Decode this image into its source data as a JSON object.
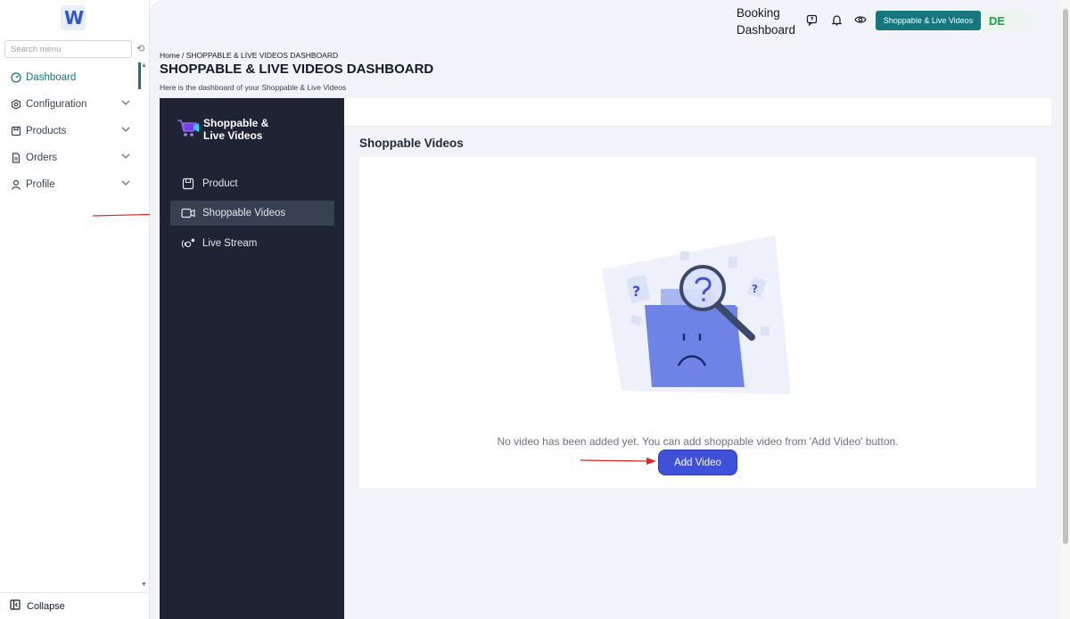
{
  "sidebar": {
    "logo_text": "W",
    "search_placeholder": "Search menu",
    "items": [
      {
        "label": "Dashboard",
        "icon": "dashboard-icon",
        "active": true
      },
      {
        "label": "Configuration",
        "icon": "settings-icon"
      },
      {
        "label": "Products",
        "icon": "products-icon"
      },
      {
        "label": "Orders",
        "icon": "orders-icon"
      },
      {
        "label": "Profile",
        "icon": "user-icon"
      }
    ],
    "collapse_label": "Collapse"
  },
  "topbar": {
    "booking_label": "Booking Dashboard",
    "app_button": "Shoppable & Live Videos",
    "user_initials": "DE"
  },
  "header": {
    "breadcrumb": "Home / SHOPPABLE & LIVE VIDEOS DASHBOARD",
    "title": "SHOPPABLE & LIVE VIDEOS DASHBOARD",
    "subtitle": "Here is the dashboard of your Shoppable & Live Videos"
  },
  "panel": {
    "brand": "Shoppable & Live Videos",
    "items": [
      {
        "label": "Product",
        "icon": "product-icon"
      },
      {
        "label": "Shoppable Videos",
        "icon": "video-icon",
        "active": true
      },
      {
        "label": "Live Stream",
        "icon": "live-stream-icon"
      }
    ]
  },
  "content": {
    "section_title": "Shoppable Videos",
    "empty_message": "No video has been added yet. You can add shoppable video from 'Add Video' button.",
    "add_button": "Add Video"
  },
  "colors": {
    "accent": "#15767d",
    "primary_button": "#3f51d8",
    "panel_bg": "#1e2433",
    "annotation_arrow": "#e02424"
  }
}
